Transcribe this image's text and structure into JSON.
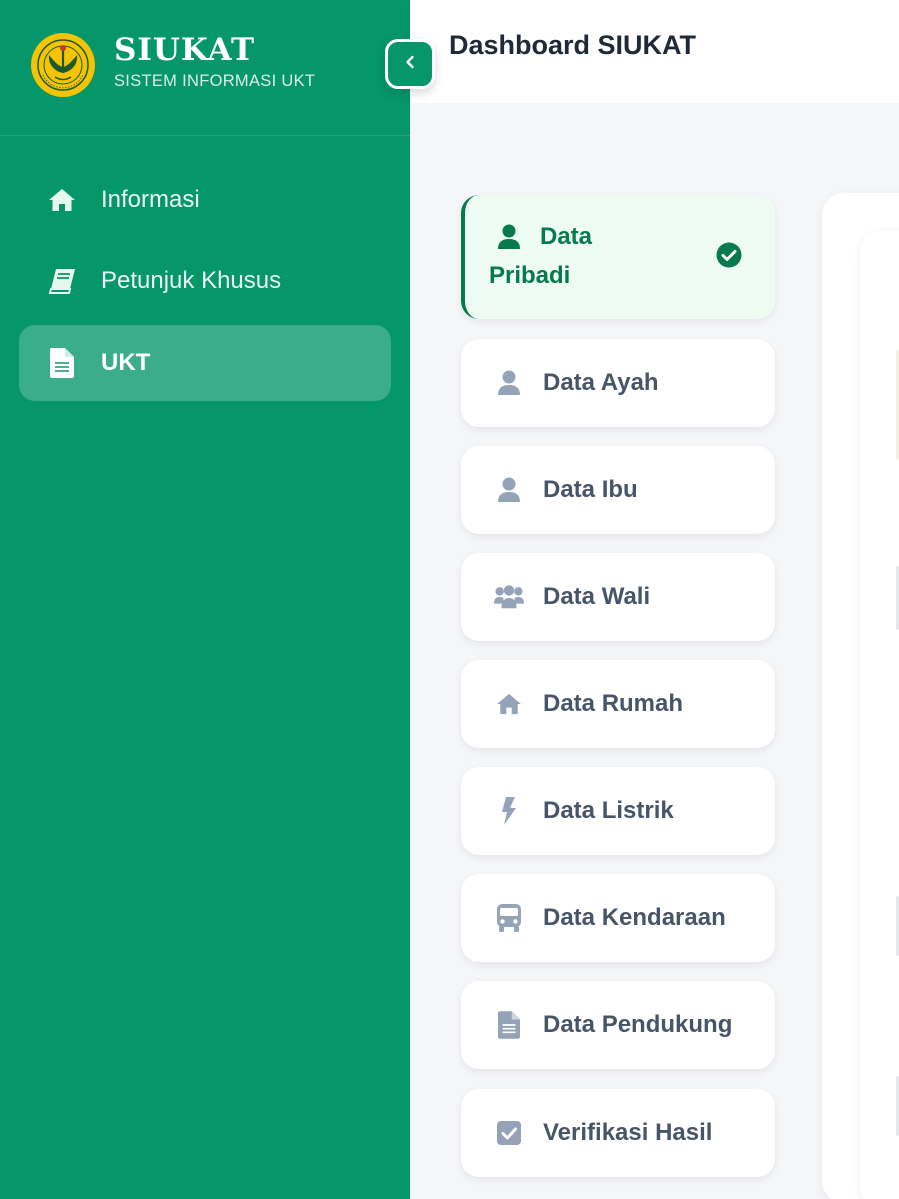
{
  "app": {
    "title": "SIUKAT",
    "subtitle": "SISTEM INFORMASI UKT",
    "logo_icon": "university-emblem-icon",
    "brand_color": "#059669"
  },
  "sidebar": {
    "items": [
      {
        "label": "Informasi",
        "icon": "home-icon",
        "active": false
      },
      {
        "label": "Petunjuk Khusus",
        "icon": "book-icon",
        "active": false
      },
      {
        "label": "UKT",
        "icon": "file-text-icon",
        "active": true
      }
    ],
    "collapse_icon": "chevron-left-icon"
  },
  "header": {
    "title": "Dashboard SIUKAT"
  },
  "steps": {
    "items": [
      {
        "label": "Data Pribadi",
        "icon": "user-icon",
        "active": true,
        "completed": true
      },
      {
        "label": "Data Ayah",
        "icon": "user-icon",
        "active": false
      },
      {
        "label": "Data Ibu",
        "icon": "user-icon",
        "active": false
      },
      {
        "label": "Data Wali",
        "icon": "users-icon",
        "active": false
      },
      {
        "label": "Data Rumah",
        "icon": "home-icon",
        "active": false
      },
      {
        "label": "Data Listrik",
        "icon": "bolt-icon",
        "active": false
      },
      {
        "label": "Data Kendaraan",
        "icon": "bus-icon",
        "active": false
      },
      {
        "label": "Data Pendukung",
        "icon": "file-text-icon",
        "active": false
      },
      {
        "label": "Verifikasi Hasil",
        "icon": "check-square-icon",
        "active": false
      }
    ],
    "active_color": "#067a4d",
    "inactive_icon_color": "#94a3b8"
  }
}
